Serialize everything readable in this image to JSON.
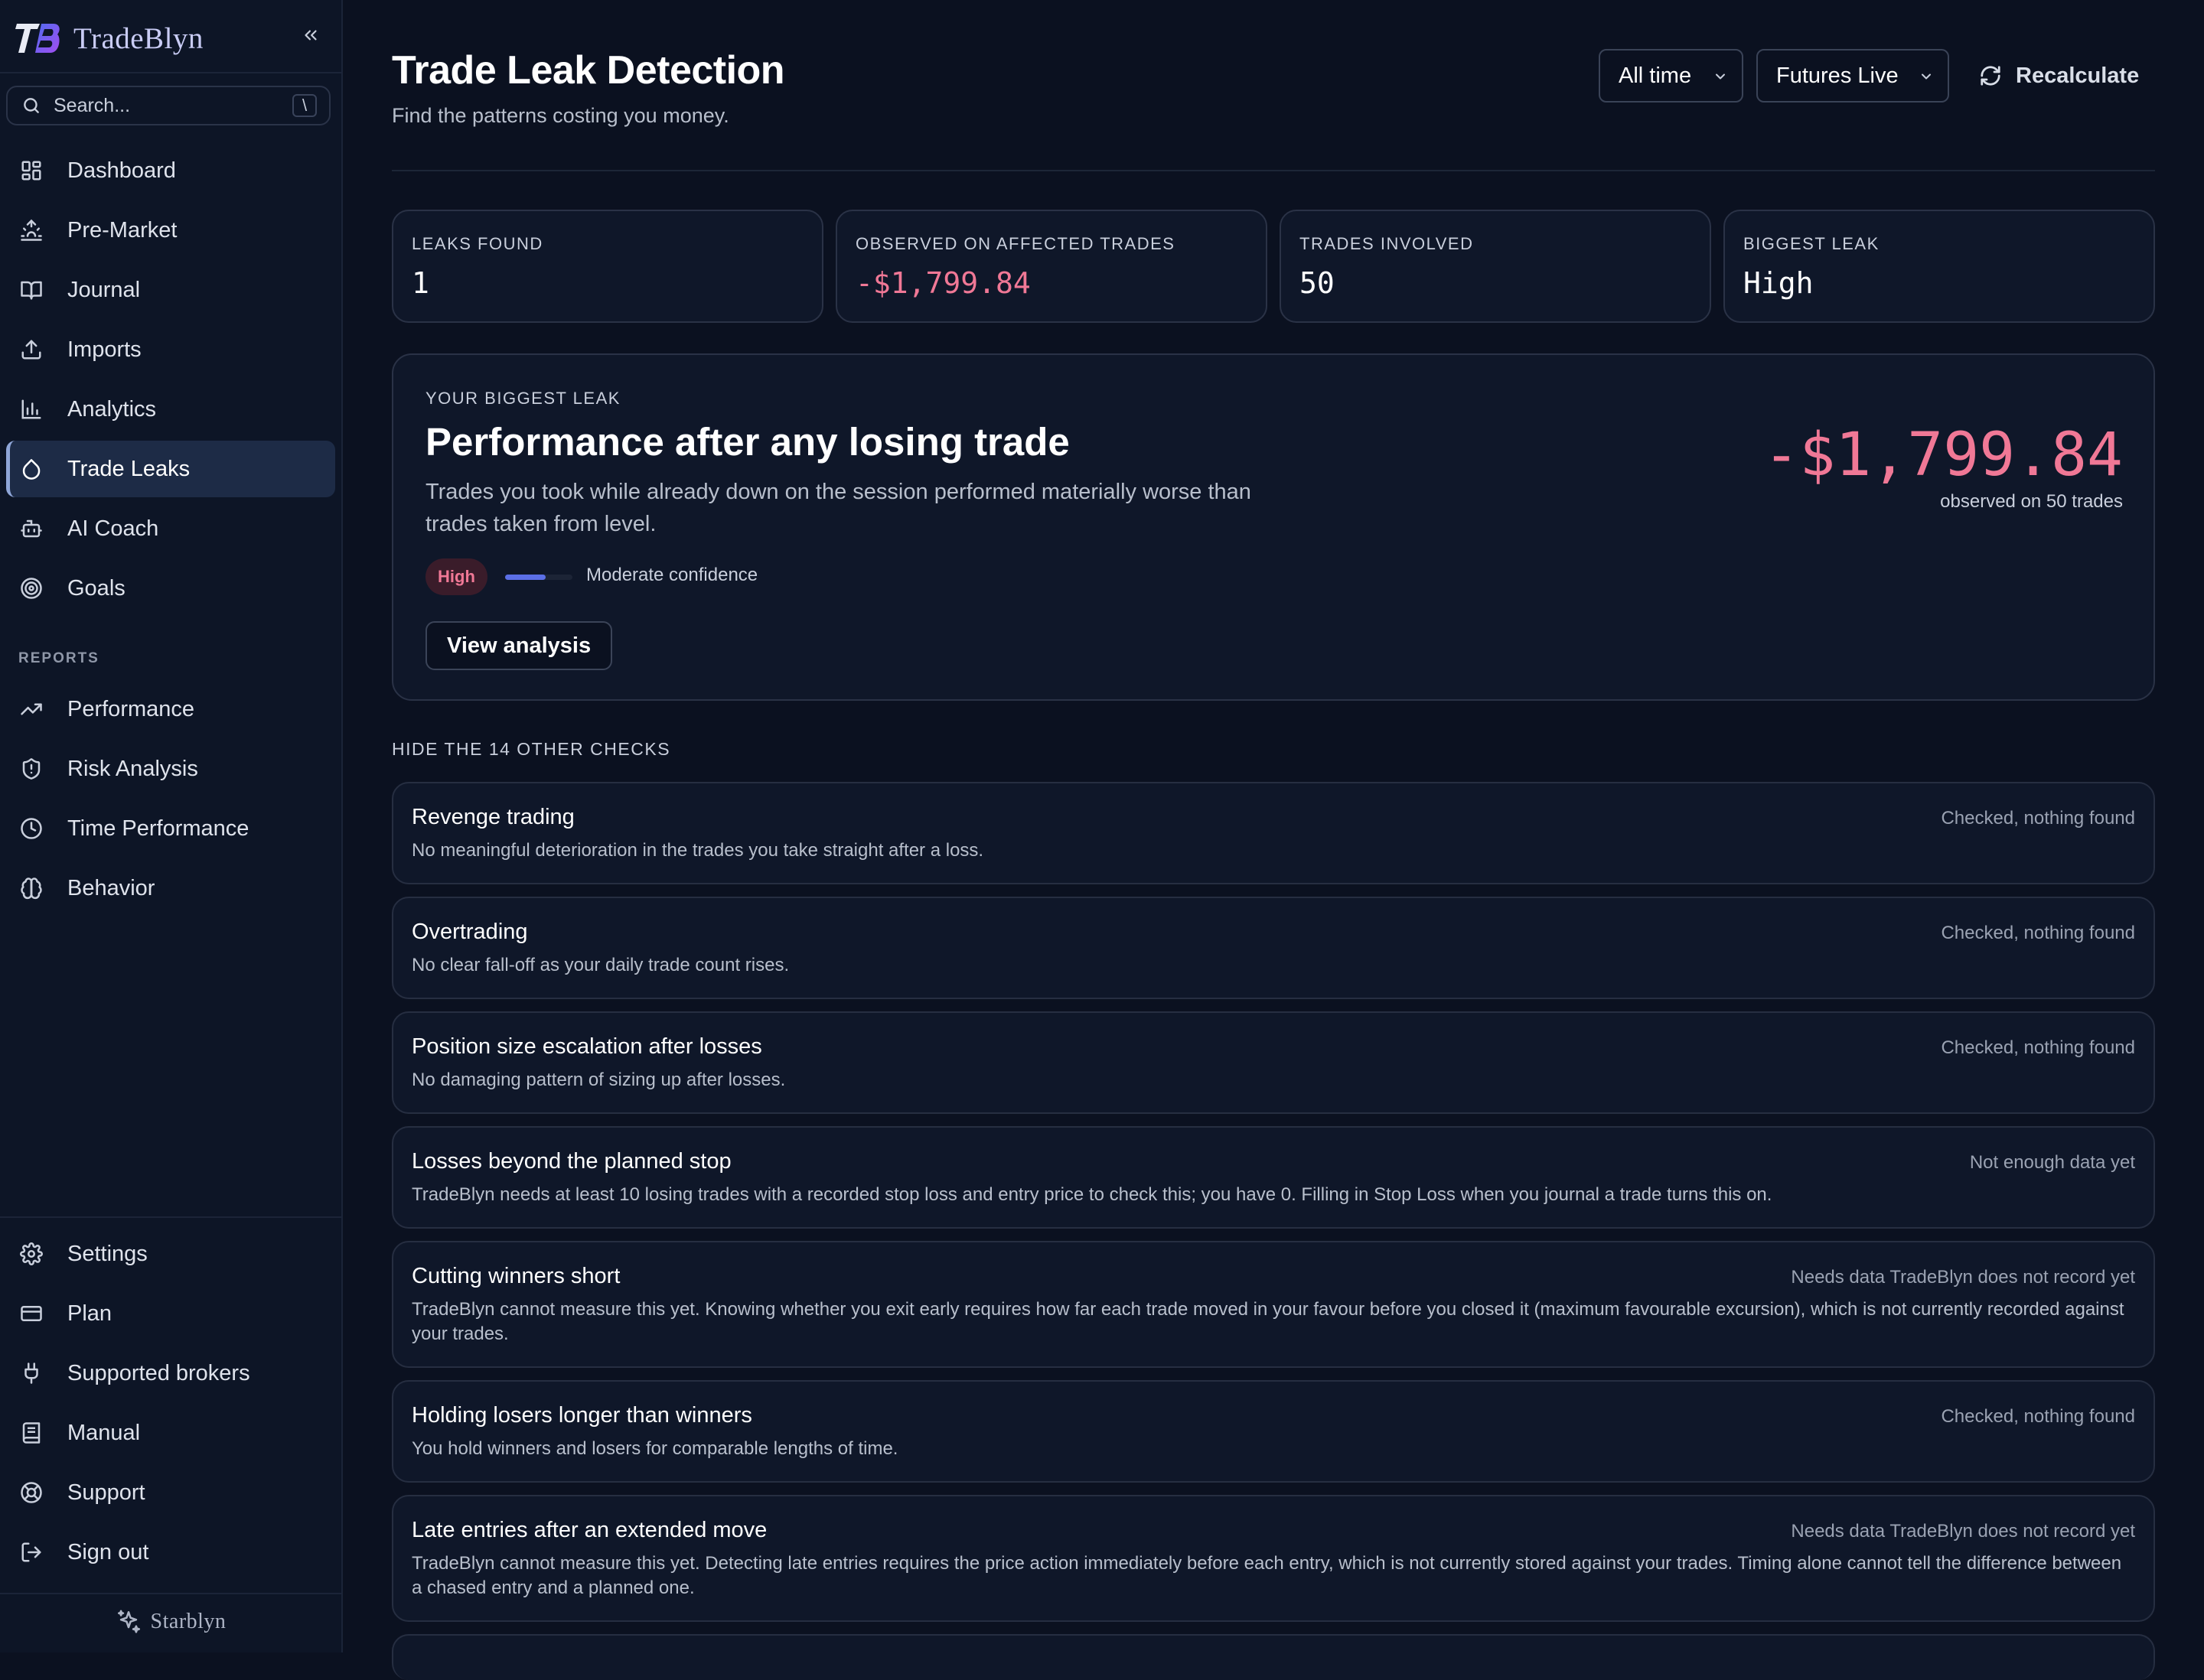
{
  "brand": {
    "name": "TradeBlyn"
  },
  "search": {
    "placeholder": "Search...",
    "shortcut": "\\"
  },
  "nav": {
    "items": [
      {
        "label": "Dashboard"
      },
      {
        "label": "Pre-Market"
      },
      {
        "label": "Journal"
      },
      {
        "label": "Imports"
      },
      {
        "label": "Analytics"
      },
      {
        "label": "Trade Leaks",
        "active": true
      },
      {
        "label": "AI Coach"
      },
      {
        "label": "Goals"
      }
    ],
    "reports_label": "REPORTS",
    "reports": [
      {
        "label": "Performance"
      },
      {
        "label": "Risk Analysis"
      },
      {
        "label": "Time Performance"
      },
      {
        "label": "Behavior"
      }
    ],
    "bottom": [
      {
        "label": "Settings"
      },
      {
        "label": "Plan"
      },
      {
        "label": "Supported brokers"
      },
      {
        "label": "Manual"
      },
      {
        "label": "Support"
      },
      {
        "label": "Sign out"
      }
    ],
    "footer": "Starblyn"
  },
  "header": {
    "title": "Trade Leak Detection",
    "subtitle": "Find the patterns costing you money.",
    "period": "All time",
    "account": "Futures Live",
    "recalculate": "Recalculate"
  },
  "stats": [
    {
      "label": "LEAKS FOUND",
      "value": "1"
    },
    {
      "label": "OBSERVED ON AFFECTED TRADES",
      "value": "-$1,799.84"
    },
    {
      "label": "TRADES INVOLVED",
      "value": "50"
    },
    {
      "label": "BIGGEST LEAK",
      "value": "High"
    }
  ],
  "biggest_leak": {
    "eyebrow": "YOUR BIGGEST LEAK",
    "title": "Performance after any losing trade",
    "description": "Trades you took while already down on the session performed materially worse than trades taken from level.",
    "severity": "High",
    "confidence_level": 0.6,
    "confidence": "Moderate confidence",
    "action": "View analysis",
    "amount": "-$1,799.84",
    "amount_note": "observed on 50 trades"
  },
  "checks_toggle": "HIDE THE 14 OTHER CHECKS",
  "checks": [
    {
      "title": "Revenge trading",
      "status": "Checked, nothing found",
      "description": "No meaningful deterioration in the trades you take straight after a loss."
    },
    {
      "title": "Overtrading",
      "status": "Checked, nothing found",
      "description": "No clear fall-off as your daily trade count rises."
    },
    {
      "title": "Position size escalation after losses",
      "status": "Checked, nothing found",
      "description": "No damaging pattern of sizing up after losses."
    },
    {
      "title": "Losses beyond the planned stop",
      "status": "Not enough data yet",
      "description": "TradeBlyn needs at least 10 losing trades with a recorded stop loss and entry price to check this; you have 0. Filling in Stop Loss when you journal a trade turns this on."
    },
    {
      "title": "Cutting winners short",
      "status": "Needs data TradeBlyn does not record yet",
      "description": "TradeBlyn cannot measure this yet. Knowing whether you exit early requires how far each trade moved in your favour before you closed it (maximum favourable excursion), which is not currently recorded against your trades."
    },
    {
      "title": "Holding losers longer than winners",
      "status": "Checked, nothing found",
      "description": "You hold winners and losers for comparable lengths of time."
    },
    {
      "title": "Late entries after an extended move",
      "status": "Needs data TradeBlyn does not record yet",
      "description": "TradeBlyn cannot measure this yet. Detecting late entries requires the price action immediately before each entry, which is not currently stored against your trades. Timing alone cannot tell the difference between a chased entry and a planned one."
    }
  ],
  "colors": {
    "accent": "#5b6fe6",
    "negative": "#f07896",
    "background": "#0b1120"
  }
}
